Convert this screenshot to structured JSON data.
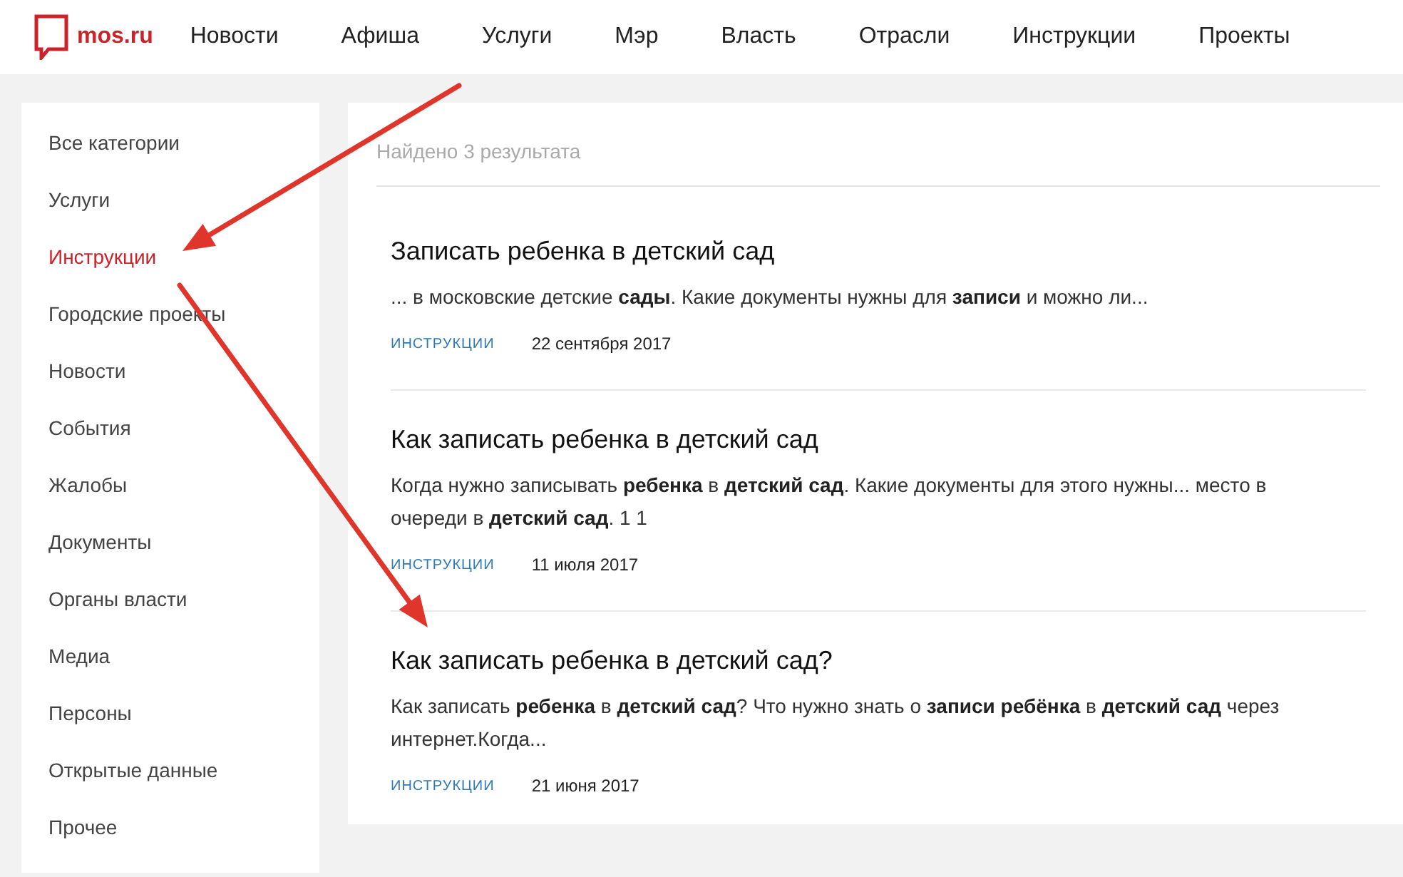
{
  "header": {
    "logo": "mos.ru",
    "nav": [
      {
        "label": "Новости"
      },
      {
        "label": "Афиша"
      },
      {
        "label": "Услуги"
      },
      {
        "label": "Мэр"
      },
      {
        "label": "Власть"
      },
      {
        "label": "Отрасли"
      },
      {
        "label": "Инструкции"
      },
      {
        "label": "Проекты"
      }
    ]
  },
  "sidebar": {
    "items": [
      {
        "label": "Все категории",
        "selected": false
      },
      {
        "label": "Услуги",
        "selected": false
      },
      {
        "label": "Инструкции",
        "selected": true
      },
      {
        "label": "Городские проекты",
        "selected": false
      },
      {
        "label": "Новости",
        "selected": false
      },
      {
        "label": "События",
        "selected": false
      },
      {
        "label": "Жалобы",
        "selected": false
      },
      {
        "label": "Документы",
        "selected": false
      },
      {
        "label": "Органы власти",
        "selected": false
      },
      {
        "label": "Медиа",
        "selected": false
      },
      {
        "label": "Персоны",
        "selected": false
      },
      {
        "label": "Открытые данные",
        "selected": false
      },
      {
        "label": "Прочее",
        "selected": false
      }
    ]
  },
  "results": {
    "count": "Найдено 3 результата",
    "items": [
      {
        "title": "Записать ребенка в детский сад",
        "snippet": "... в московские детские **сады**. Какие документы нужны для **записи** и можно ли...",
        "tag": "ИНСТРУКЦИИ",
        "date": "22 сентября 2017"
      },
      {
        "title": "Как записать ребенка в детский сад",
        "snippet": "Когда нужно записывать **ребенка** в **детский сад**. Какие документы для этого нужны... место в очереди в **детский сад**. 1 1",
        "tag": "ИНСТРУКЦИИ",
        "date": "11 июля 2017"
      },
      {
        "title": "Как записать ребенка в детский сад?",
        "snippet": "Как записать **ребенка** в **детский сад**? Что нужно знать о **записи ребёнка** в **детский сад** через интернет.Когда...",
        "tag": "ИНСТРУКЦИИ",
        "date": "21 июня 2017"
      }
    ]
  },
  "annotations": [
    {
      "kind": "arrow"
    },
    {
      "kind": "arrow"
    }
  ]
}
